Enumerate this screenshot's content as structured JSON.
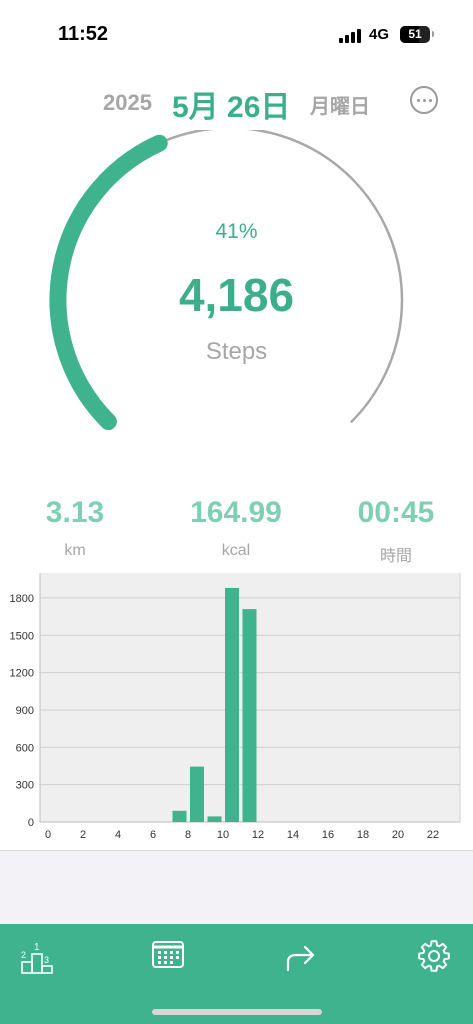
{
  "status_bar": {
    "time": "11:52",
    "network": "4G",
    "battery": "51",
    "battery_fraction": 0.62
  },
  "header": {
    "year": "2025",
    "date": "5月 26日",
    "weekday": "月曜日",
    "more_icon": "ellipsis-circle-icon"
  },
  "progress": {
    "percent_label": "41%",
    "fraction": 0.41,
    "steps": "4,186",
    "steps_label": "Steps"
  },
  "stats": [
    {
      "value": "3.13",
      "unit": "km"
    },
    {
      "value": "164.99",
      "unit": "kcal"
    },
    {
      "value": "00:45",
      "unit": "時間"
    }
  ],
  "colors": {
    "accent": "#3fb38d",
    "accent_light": "#7fcfb3",
    "gray_text": "#a6a6a6",
    "ring_track": "#a8a8a8"
  },
  "chart_data": {
    "type": "bar",
    "x": [
      0,
      1,
      2,
      3,
      4,
      5,
      6,
      7,
      8,
      9,
      10,
      11,
      12,
      13,
      14,
      15,
      16,
      17,
      18,
      19,
      20,
      21,
      22,
      23
    ],
    "values": [
      0,
      0,
      0,
      0,
      0,
      0,
      0,
      90,
      445,
      45,
      1880,
      1710,
      0,
      0,
      0,
      0,
      0,
      0,
      0,
      0,
      0,
      0,
      0,
      0
    ],
    "x_ticks": [
      0,
      2,
      4,
      6,
      8,
      10,
      12,
      14,
      16,
      18,
      20,
      22
    ],
    "y_ticks": [
      0,
      300,
      600,
      900,
      1200,
      1500,
      1800
    ],
    "ylim": [
      0,
      2000
    ],
    "grid": true,
    "title": "",
    "xlabel": "",
    "ylabel": ""
  },
  "tab_bar": {
    "items": [
      {
        "icon": "podium-ranking-icon",
        "labels": [
          "2",
          "1",
          "3"
        ]
      },
      {
        "icon": "calendar-icon"
      },
      {
        "icon": "share-arrow-icon"
      },
      {
        "icon": "gear-icon"
      }
    ]
  }
}
